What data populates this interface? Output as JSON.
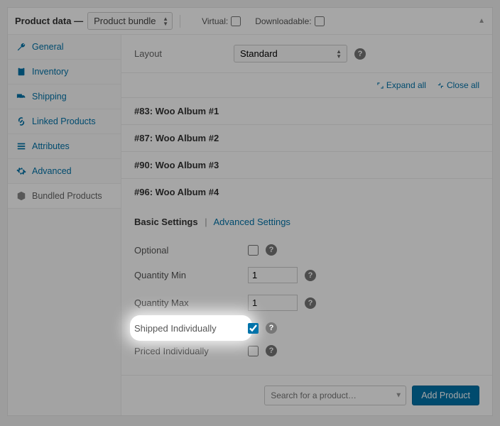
{
  "header": {
    "title": "Product data —",
    "product_type": "Product bundle",
    "virtual_label": "Virtual:",
    "downloadable_label": "Downloadable:"
  },
  "tabs": {
    "general": "General",
    "inventory": "Inventory",
    "shipping": "Shipping",
    "linked": "Linked Products",
    "attributes": "Attributes",
    "advanced": "Advanced",
    "bundled": "Bundled Products"
  },
  "layout": {
    "label": "Layout",
    "value": "Standard"
  },
  "expand": {
    "expand_all": "Expand all",
    "close_all": "Close all"
  },
  "items": [
    "#83: Woo Album #1",
    "#87: Woo Album #2",
    "#90: Woo Album #3",
    "#96: Woo Album #4"
  ],
  "settings_tabs": {
    "basic": "Basic Settings",
    "advanced": "Advanced Settings"
  },
  "fields": {
    "optional": "Optional",
    "qty_min": {
      "label": "Quantity Min",
      "value": "1"
    },
    "qty_max": {
      "label": "Quantity Max",
      "value": "1"
    },
    "shipped": "Shipped Individually",
    "priced": "Priced Individually"
  },
  "footer": {
    "search_placeholder": "Search for a product…",
    "add_button": "Add Product"
  }
}
